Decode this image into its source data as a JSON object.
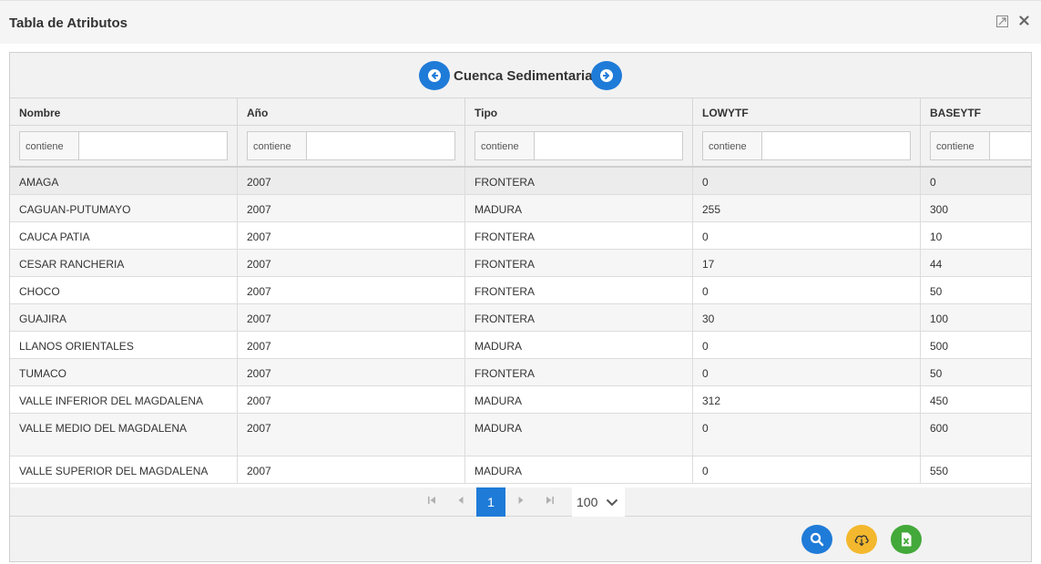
{
  "window": {
    "title": "Tabla de Atributos",
    "expand_icon": "expand-icon",
    "close_icon": "close-icon"
  },
  "layer": {
    "title": "Cuenca Sedimentaria",
    "prev_icon": "arrow-left-circle-icon",
    "next_icon": "arrow-right-circle-icon"
  },
  "table": {
    "columns": [
      {
        "label": "Nombre",
        "filter_operator": "contiene",
        "filter_value": ""
      },
      {
        "label": "Año",
        "filter_operator": "contiene",
        "filter_value": ""
      },
      {
        "label": "Tipo",
        "filter_operator": "contiene",
        "filter_value": ""
      },
      {
        "label": "LOWYTF",
        "filter_operator": "contiene",
        "filter_value": ""
      },
      {
        "label": "BASEYTF",
        "filter_operator": "contiene",
        "filter_value": ""
      }
    ],
    "rows": [
      [
        "AMAGA",
        "2007",
        "FRONTERA",
        "0",
        "0"
      ],
      [
        "CAGUAN-PUTUMAYO",
        "2007",
        "MADURA",
        "255",
        "300"
      ],
      [
        "CAUCA PATIA",
        "2007",
        "FRONTERA",
        "0",
        "10"
      ],
      [
        "CESAR RANCHERIA",
        "2007",
        "FRONTERA",
        "17",
        "44"
      ],
      [
        "CHOCO",
        "2007",
        "FRONTERA",
        "0",
        "50"
      ],
      [
        "GUAJIRA",
        "2007",
        "FRONTERA",
        "30",
        "100"
      ],
      [
        "LLANOS ORIENTALES",
        "2007",
        "MADURA",
        "0",
        "500"
      ],
      [
        "TUMACO",
        "2007",
        "FRONTERA",
        "0",
        "50"
      ],
      [
        "VALLE INFERIOR DEL MAGDALENA",
        "2007",
        "MADURA",
        "312",
        "450"
      ],
      [
        "VALLE MEDIO DEL MAGDALENA",
        "2007",
        "MADURA",
        "0",
        "600"
      ],
      [
        "VALLE SUPERIOR DEL MAGDALENA",
        "2007",
        "MADURA",
        "0",
        "550"
      ]
    ],
    "selected_row": 0
  },
  "pagination": {
    "current_page": "1",
    "page_size": "100",
    "icons": [
      "first-page-icon",
      "prev-page-icon",
      "next-page-icon",
      "last-page-icon"
    ]
  },
  "actions": [
    {
      "icon": "search-icon",
      "color": "#1f7bd8"
    },
    {
      "icon": "cloud-download-icon",
      "color": "#f4b82e"
    },
    {
      "icon": "excel-file-icon",
      "color": "#43a93a"
    }
  ],
  "colors": {
    "accent": "#1f7bd8",
    "selected_row": "#ececec",
    "alt_row": "#f6f6f6"
  }
}
